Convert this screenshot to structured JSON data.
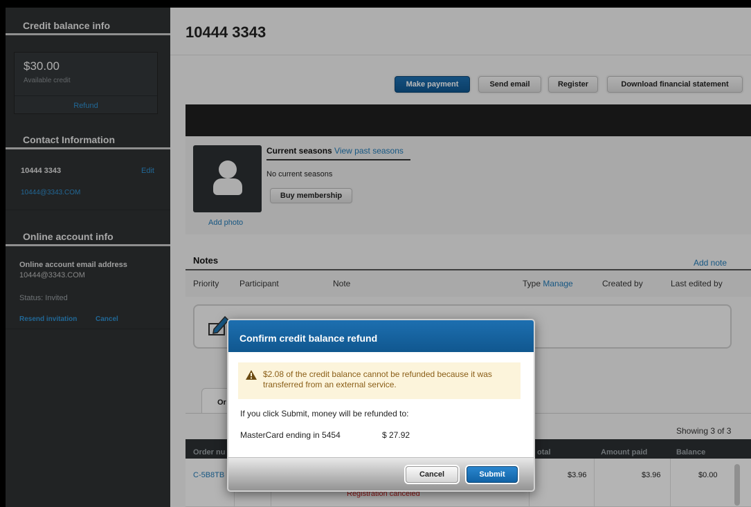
{
  "sidebar": {
    "credit_heading": "Credit balance info",
    "credit_amount": "$30.00",
    "credit_label": "Available credit",
    "refund_link": "Refund",
    "contact_heading": "Contact Information",
    "contact_name": "10444 3343",
    "edit_link": "Edit",
    "contact_email": "10444@3343.COM",
    "online_heading": "Online account info",
    "online_email_label": "Online account email address",
    "online_email": "10444@3343.COM",
    "status": "Status: Invited",
    "resend_link": "Resend invitation",
    "cancel_link": "Cancel"
  },
  "main": {
    "title": "10444 3343",
    "toolbar": {
      "make_payment": "Make payment",
      "send_email": "Send email",
      "register": "Register",
      "download_statement": "Download financial statement"
    },
    "seasons": {
      "current_label": "Current seasons",
      "view_past": "View past seasons",
      "no_current": "No current seasons",
      "buy_membership": "Buy membership",
      "add_photo": "Add photo"
    },
    "notes": {
      "title": "Notes",
      "add_note": "Add note",
      "columns": {
        "priority": "Priority",
        "participant": "Participant",
        "note": "Note",
        "type": "Type",
        "manage": "Manage",
        "created_by": "Created by",
        "last_edited_by": "Last edited by"
      }
    },
    "orders": {
      "tab_label": "Or",
      "showing": "Showing 3 of 3",
      "columns": {
        "order_number": "Order nu",
        "total": "otal",
        "amount_paid": "Amount paid",
        "balance": "Balance"
      },
      "row": {
        "order_number": "C-5B8TB",
        "status": "Registration canceled",
        "total": "$3.96",
        "amount_paid": "$3.96",
        "balance": "$0.00"
      }
    }
  },
  "modal": {
    "title": "Confirm credit balance refund",
    "warning": "$2.08 of the credit balance cannot be refunded because it was transferred from an external service.",
    "refund_to_text": "If you click Submit, money will be refunded to:",
    "card_label": "MasterCard ending in 5454",
    "card_amount": "$ 27.92",
    "cancel_label": "Cancel",
    "submit_label": "Submit"
  },
  "colors": {
    "accent_blue": "#1f78b4",
    "primary_button": "#0f568f",
    "sidebar_bg": "#2e3133",
    "warning_bg": "#fcf4db",
    "warning_text": "#8a5e17",
    "canceled_red": "#cc2222"
  }
}
